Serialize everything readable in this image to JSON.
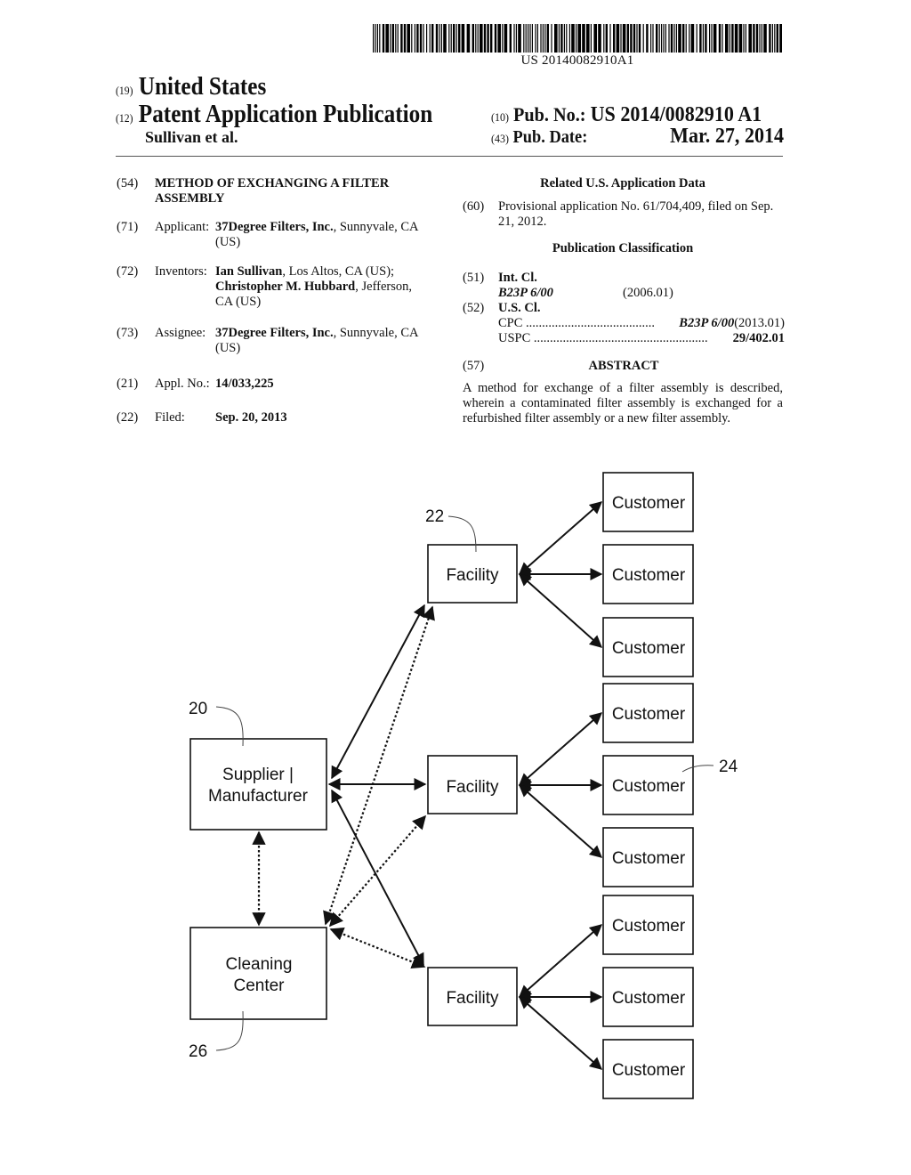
{
  "barcode": {
    "number": "US 20140082910A1"
  },
  "header": {
    "country_code": "(19)",
    "country": "United States",
    "type_code": "(12)",
    "type": "Patent Application Publication",
    "authors": "Sullivan et al.",
    "pub_no_code": "(10)",
    "pub_no_label": "Pub. No.:",
    "pub_no": "US 2014/0082910 A1",
    "pub_date_code": "(43)",
    "pub_date_label": "Pub. Date:",
    "pub_date": "Mar. 27, 2014"
  },
  "left_column": {
    "title": {
      "code": "(54)",
      "line1": "METHOD OF EXCHANGING A FILTER",
      "line2": "ASSEMBLY"
    },
    "applicant": {
      "code": "(71)",
      "label": "Applicant:",
      "name": "37Degree Filters, Inc.",
      "location": ", Sunnyvale, CA",
      "location2": "(US)"
    },
    "inventors": {
      "code": "(72)",
      "label": "Inventors:",
      "name1": "Ian Sullivan",
      "loc1": ", Los Altos, CA (US);",
      "name2": "Christopher M. Hubbard",
      "loc2": ", Jefferson,",
      "loc2b": "CA (US)"
    },
    "assignee": {
      "code": "(73)",
      "label": "Assignee:",
      "name": "37Degree Filters, Inc.",
      "location": ", Sunnyvale, CA",
      "location2": "(US)"
    },
    "appl_no": {
      "code": "(21)",
      "label": "Appl. No.:",
      "value": "14/033,225"
    },
    "filed": {
      "code": "(22)",
      "label": "Filed:",
      "value": "Sep. 20, 2013"
    }
  },
  "right_column": {
    "related_heading": "Related U.S. Application Data",
    "provisional": {
      "code": "(60)",
      "line1": "Provisional application No. 61/704,409, filed on Sep.",
      "line2": "21, 2012."
    },
    "classification_heading": "Publication Classification",
    "int_cl": {
      "code": "(51)",
      "label": "Int. Cl.",
      "class": "B23P 6/00",
      "version": "(2006.01)"
    },
    "us_cl": {
      "code": "(52)",
      "label": "U.S. Cl.",
      "cpc_label": "CPC",
      "cpc_dots": "........................................",
      "cpc_class": "B23P 6/00",
      "cpc_version": " (2013.01)",
      "uspc_label": "USPC",
      "uspc_dots": "......................................................",
      "uspc_value": "29/402.01"
    },
    "abstract": {
      "code": "(57)",
      "heading": "ABSTRACT",
      "text": "A method for exchange of a filter assembly is described, wherein a contaminated filter assembly is exchanged for a refurbished filter assembly or a new filter assembly."
    }
  },
  "diagram": {
    "supplier": {
      "line1": "Supplier |",
      "line2": "Manufacturer",
      "ref": "20"
    },
    "cleaning": {
      "line1": "Cleaning",
      "line2": "Center",
      "ref": "26"
    },
    "facilities": [
      {
        "label": "Facility",
        "ref": "22"
      },
      {
        "label": "Facility"
      },
      {
        "label": "Facility"
      }
    ],
    "customers": [
      "Customer",
      "Customer",
      "Customer",
      "Customer",
      "Customer",
      "Customer",
      "Customer",
      "Customer",
      "Customer"
    ],
    "customer_ref": "24"
  }
}
